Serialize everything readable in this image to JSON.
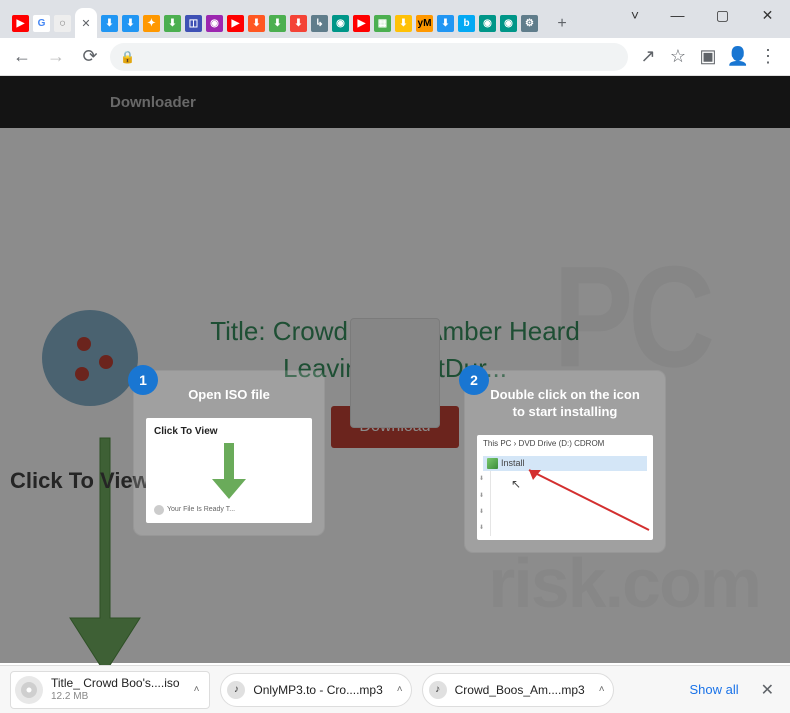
{
  "window": {
    "controls": {
      "expand": "˅",
      "min": "—",
      "max": "▢",
      "close": "✕"
    }
  },
  "tabs": {
    "new_tab": "+",
    "active_close": "✕"
  },
  "addrbar": {
    "back": "←",
    "fwd": "→",
    "reload": "⟳",
    "lock": "🔒",
    "share": "↗",
    "star": "☆",
    "ext": "▣",
    "profile": "👤",
    "menu": "⋮"
  },
  "page": {
    "header_title": "Downloader",
    "content_title": "Title: Crowd Boo's Amber Heard Leaving CourtDur...",
    "download_label": "Download",
    "ctv_label": "Click To View"
  },
  "overlay": {
    "step1": {
      "num": "1",
      "title": "Open ISO file",
      "thumb_label": "Click To View",
      "thumb_footer": "Your File Is Ready T..."
    },
    "step2": {
      "num": "2",
      "title": "Double click on the icon to start installing",
      "crumb": "This PC  ›  DVD Drive (D:) CDROM",
      "install_label": "Install",
      "cursor": "↖"
    }
  },
  "downloads": {
    "items": [
      {
        "name": "Title_ Crowd Boo's....iso",
        "size": "12.2 MB"
      },
      {
        "name": "OnlyMP3.to - Cro....mp3"
      },
      {
        "name": "Crowd_Boos_Am....mp3"
      }
    ],
    "show_all": "Show all",
    "close": "✕",
    "chevron": "˄"
  }
}
